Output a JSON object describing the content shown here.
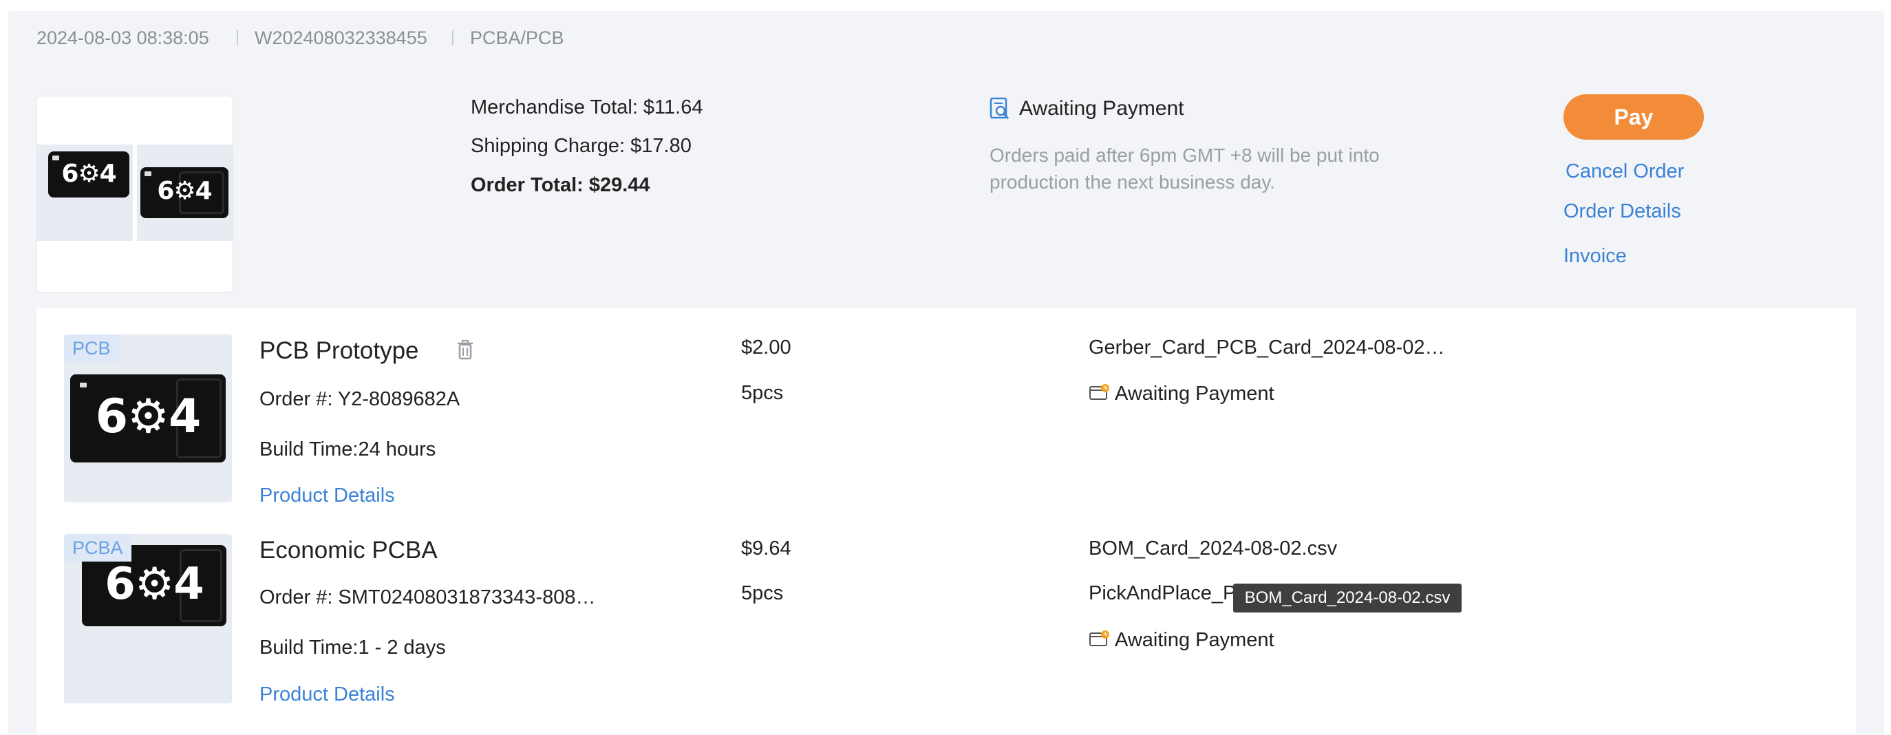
{
  "order": {
    "date": "2024-08-03 08:38:05",
    "number": "W202408032338455",
    "category": "PCBA/PCB",
    "merchandise_total": "Merchandise Total: $11.64",
    "shipping_charge": "Shipping Charge: $17.80",
    "order_total": "Order Total: $29.44",
    "status": "Awaiting Payment",
    "status_icon": "document-search-icon",
    "note": "Orders paid after 6pm GMT +8 will be put into production the next business day.",
    "actions": {
      "pay": "Pay",
      "cancel": "Cancel Order",
      "details": "Order Details",
      "invoice": "Invoice"
    },
    "thumbnail_text": "6⚙4"
  },
  "items": [
    {
      "tag": "PCB",
      "title": "PCB Prototype",
      "order_no": "Order #: Y2-8089682A",
      "build_time": "Build Time:24 hours",
      "details_link": "Product Details",
      "price": "$2.00",
      "qty": "5pcs",
      "files": [
        "Gerber_Card_PCB_Card_2024-08-02…"
      ],
      "status": "Awaiting Payment",
      "status_icon": "wallet-clock-icon",
      "delete_icon": "trash-icon",
      "thumbnail_text": "6⚙4"
    },
    {
      "tag": "PCBA",
      "title": "Economic PCBA",
      "order_no": "Order #: SMT02408031873343-808…",
      "build_time": "Build Time:1 - 2 days",
      "details_link": "Product Details",
      "price": "$9.64",
      "qty": "5pcs",
      "files": [
        "BOM_Card_2024-08-02.csv",
        "PickAndPlace_P"
      ],
      "status": "Awaiting Payment",
      "status_icon": "wallet-clock-icon",
      "thumbnail_text": "6⚙4"
    }
  ],
  "tooltip": "BOM_Card_2024-08-02.csv",
  "colors": {
    "accent_orange": "#f28c38",
    "link_blue": "#3b82d6",
    "card_bg": "#f3f4f7",
    "tag_text": "#6aa1e3"
  }
}
